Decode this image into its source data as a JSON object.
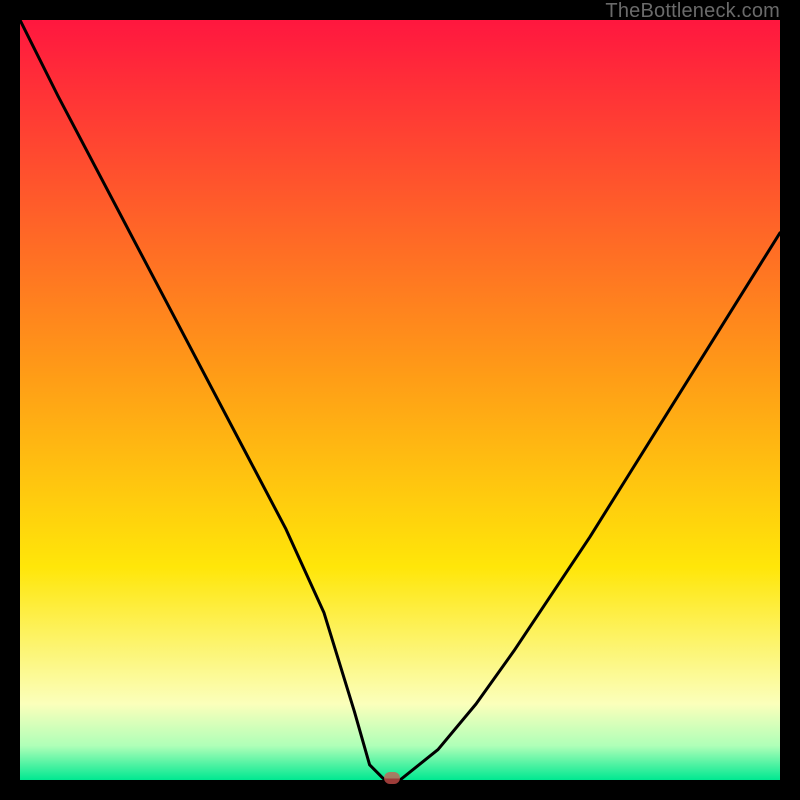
{
  "watermark": "TheBottleneck.com",
  "colors": {
    "red": "#ff173f",
    "yellow": "#ffe609",
    "cream": "#fbffbb",
    "green": "#00e891",
    "black": "#000000",
    "curve": "#000000",
    "marker": "#d9534f"
  },
  "chart_data": {
    "type": "line",
    "title": "",
    "xlabel": "",
    "ylabel": "",
    "xlim": [
      0,
      100
    ],
    "ylim": [
      0,
      100
    ],
    "x": [
      0,
      5,
      10,
      15,
      20,
      25,
      30,
      35,
      40,
      44,
      46,
      48,
      50,
      55,
      60,
      65,
      70,
      75,
      80,
      85,
      90,
      95,
      100
    ],
    "values": [
      100,
      90,
      80.5,
      71,
      61.5,
      52,
      42.5,
      33,
      22,
      9,
      2,
      0,
      0,
      4,
      10,
      17,
      24.5,
      32,
      40,
      48,
      56,
      64,
      72
    ],
    "marker": {
      "x": 49,
      "y": 0
    },
    "gradient_stops": [
      {
        "offset": 0.0,
        "color": "#ff173f"
      },
      {
        "offset": 0.46,
        "color": "#ff9a17"
      },
      {
        "offset": 0.72,
        "color": "#ffe609"
      },
      {
        "offset": 0.9,
        "color": "#fbffbb"
      },
      {
        "offset": 0.955,
        "color": "#afffb8"
      },
      {
        "offset": 1.0,
        "color": "#00e891"
      }
    ]
  }
}
